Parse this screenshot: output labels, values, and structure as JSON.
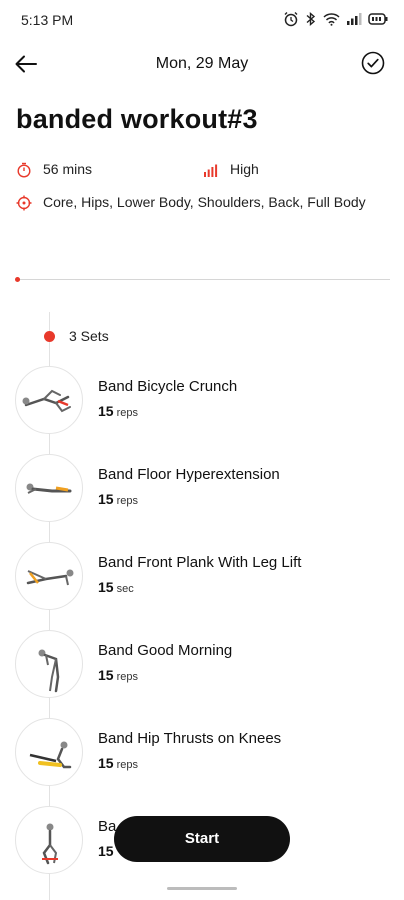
{
  "status_bar": {
    "time": "5:13 PM",
    "icons": [
      "alarm-icon",
      "bluetooth-icon",
      "wifi-icon",
      "signal-icon",
      "battery-icon"
    ]
  },
  "header": {
    "date": "Mon, 29 May",
    "back_icon": "arrow-left-icon",
    "done_icon": "check-circle-icon"
  },
  "workout": {
    "title": "banded workout#3",
    "duration": "56 mins",
    "intensity": "High",
    "focus": "Core, Hips, Lower Body, Shoulders, Back, Full Body",
    "progress": 0.01
  },
  "sets": {
    "label": "3 Sets"
  },
  "exercises": [
    {
      "name": "Band Bicycle Crunch",
      "amount": "15",
      "unit": "reps"
    },
    {
      "name": "Band Floor Hyperextension",
      "amount": "15",
      "unit": "reps"
    },
    {
      "name": "Band Front Plank With Leg Lift",
      "amount": "15",
      "unit": "sec"
    },
    {
      "name": "Band Good Morning",
      "amount": "15",
      "unit": "reps"
    },
    {
      "name": "Band Hip Thrusts on Knees",
      "amount": "15",
      "unit": "reps"
    },
    {
      "name": "Ba",
      "amount": "15",
      "unit": ""
    }
  ],
  "actions": {
    "start_label": "Start"
  },
  "colors": {
    "accent": "#e8392b",
    "button": "#111111"
  }
}
